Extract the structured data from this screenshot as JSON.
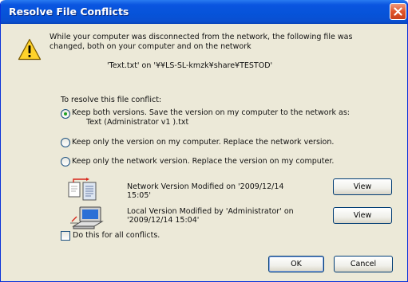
{
  "window": {
    "title": "Resolve File Conflicts"
  },
  "message": {
    "line1": "While your computer was disconnected from the network, the following file was",
    "line2": "changed, both on your computer and on the network",
    "file_line": "'Text.txt' on '¥¥LS-SL-kmzk¥share¥TESTOD'"
  },
  "resolve": {
    "heading": "To resolve this file conflict:",
    "options": [
      {
        "line1": "Keep both versions. Save the version on my computer to the network as:",
        "line2": "Text (Administrator v1 ).txt",
        "checked": true
      },
      {
        "line1": "Keep only the version on my computer. Replace the network version.",
        "checked": false
      },
      {
        "line1": "Keep only the network version. Replace the version on my computer.",
        "checked": false
      }
    ]
  },
  "network_version": {
    "line1": "Network Version Modified on '2009/12/14",
    "line2": "15:05'",
    "button": "View"
  },
  "local_version": {
    "line1": "Local Version Modified by 'Administrator' on",
    "line2": "'2009/12/14 15:04'",
    "button": "View"
  },
  "apply_all": {
    "label": "Do this for all conflicts.",
    "checked": false
  },
  "buttons": {
    "ok": "OK",
    "cancel": "Cancel"
  },
  "icons": {
    "warning": "warning-icon",
    "network": "network-files-icon",
    "computer": "computer-icon",
    "close": "close-icon"
  },
  "colors": {
    "titlebar": "#0653d8",
    "dialog_bg": "#ece9d8",
    "close": "#e0542a"
  }
}
